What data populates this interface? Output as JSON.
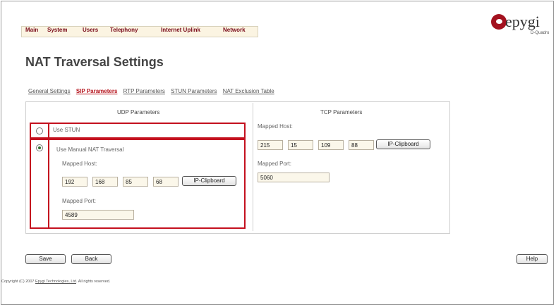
{
  "nav": {
    "items": [
      "Main",
      "System",
      "Users",
      "Telephony",
      "Internet Uplink",
      "Network"
    ]
  },
  "logo": {
    "word": "epygi",
    "subtitle": "D-Quadro"
  },
  "page_title": "NAT Traversal Settings",
  "tabs": [
    {
      "label": "General Settings",
      "active": false
    },
    {
      "label": "SIP Parameters",
      "active": true
    },
    {
      "label": "RTP Parameters",
      "active": false
    },
    {
      "label": "STUN Parameters",
      "active": false
    },
    {
      "label": "NAT Exclusion Table",
      "active": false
    }
  ],
  "udp": {
    "title": "UDP Parameters",
    "use_stun_label": "Use STUN",
    "use_manual_label": "Use Manual NAT Traversal",
    "mapped_host_label": "Mapped Host:",
    "ip": [
      "192",
      "168",
      "85",
      "68"
    ],
    "ip_clipboard_label": "IP-Clipboard",
    "mapped_port_label": "Mapped Port:",
    "mapped_port_value": "4589",
    "selected": "manual"
  },
  "tcp": {
    "title": "TCP Parameters",
    "mapped_host_label": "Mapped Host:",
    "ip": [
      "215",
      "15",
      "109",
      "88"
    ],
    "ip_clipboard_label": "IP-Clipboard",
    "mapped_port_label": "Mapped Port:",
    "mapped_port_value": "5060"
  },
  "buttons": {
    "save": "Save",
    "back": "Back",
    "help": "Help"
  },
  "footer": {
    "prefix": "Copyright (C) 2007 ",
    "company": "Epygi Technologies, Ltd",
    "suffix": ". All rights reserved."
  },
  "colors": {
    "accent": "#c4101e",
    "menu_text": "#7a0b1a",
    "field_bg": "#fbf7ea"
  }
}
